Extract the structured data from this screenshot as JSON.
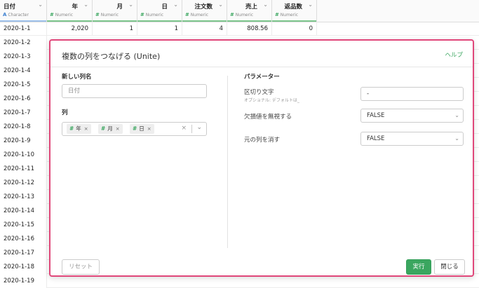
{
  "grid": {
    "columns": [
      {
        "name": "日付",
        "type": "Character",
        "type_icon": "A"
      },
      {
        "name": "年",
        "type": "Numeric",
        "type_icon": "#"
      },
      {
        "name": "月",
        "type": "Numeric",
        "type_icon": "#"
      },
      {
        "name": "日",
        "type": "Numeric",
        "type_icon": "#"
      },
      {
        "name": "注文数",
        "type": "Numeric",
        "type_icon": "#"
      },
      {
        "name": "売上",
        "type": "Numeric",
        "type_icon": "#"
      },
      {
        "name": "返品数",
        "type": "Numeric",
        "type_icon": "#"
      }
    ],
    "first_row": [
      "2020-1-1",
      "2,020",
      "1",
      "1",
      "4",
      "808.56",
      "0"
    ],
    "dates": [
      "2020-1-2",
      "2020-1-3",
      "2020-1-4",
      "2020-1-5",
      "2020-1-6",
      "2020-1-7",
      "2020-1-8",
      "2020-1-9",
      "2020-1-10",
      "2020-1-11",
      "2020-1-12",
      "2020-1-13",
      "2020-1-14",
      "2020-1-15",
      "2020-1-16",
      "2020-1-17",
      "2020-1-18",
      "2020-1-19"
    ]
  },
  "dialog": {
    "title": "複数の列をつなげる (Unite)",
    "help_link": "ヘルプ",
    "new_column_label": "新しい列名",
    "new_column_placeholder": "日付",
    "columns_label": "列",
    "selected_columns": [
      "年",
      "月",
      "日"
    ],
    "params_title": "パラメーター",
    "separator_label": "区切り文字",
    "separator_note": "オプショナル: デフォルトは_",
    "separator_value": "-",
    "na_label": "欠損値を無視する",
    "na_value": "FALSE",
    "remove_label": "元の列を消す",
    "remove_value": "FALSE",
    "reset_button": "リセット",
    "run_button": "実行",
    "close_button": "閉じる"
  },
  "colors": {
    "accent_green": "#3aa65f",
    "modal_border": "#e0477a",
    "character_type": "#3b7fd0"
  }
}
